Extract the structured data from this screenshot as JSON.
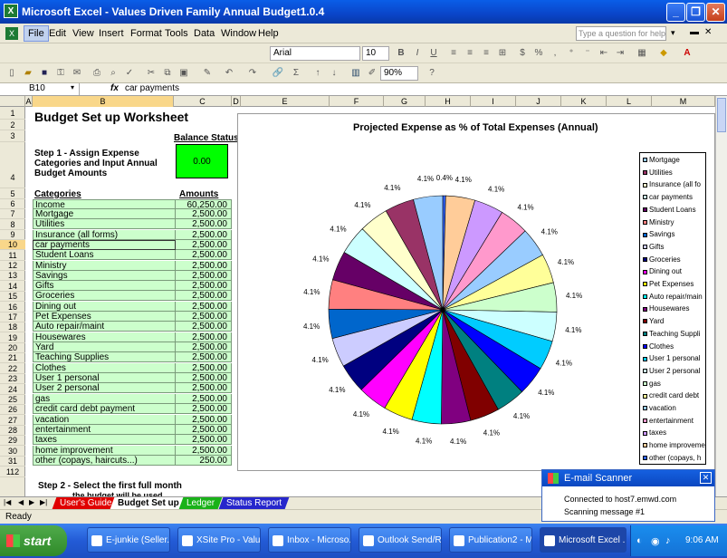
{
  "window": {
    "title": "Microsoft Excel - Values Driven Family Annual Budget1.0.4"
  },
  "menu": [
    "File",
    "Edit",
    "View",
    "Insert",
    "Format",
    "Tools",
    "Data",
    "Window",
    "Help"
  ],
  "help_placeholder": "Type a question for help",
  "format_bar": {
    "font": "Arial",
    "size": "10"
  },
  "std_bar": {
    "zoom": "90%"
  },
  "formula_bar": {
    "cell_ref": "B10",
    "fx": "fx",
    "content": "car payments"
  },
  "columns": [
    "A",
    "B",
    "C",
    "D",
    "E",
    "F",
    "G",
    "H",
    "I",
    "J",
    "K",
    "L",
    "M"
  ],
  "rows": [
    "1",
    "2",
    "3",
    "4",
    "5",
    "6",
    "7",
    "8",
    "9",
    "10",
    "11",
    "12",
    "13",
    "14",
    "15",
    "16",
    "17",
    "18",
    "19",
    "20",
    "21",
    "22",
    "23",
    "24",
    "25",
    "26",
    "27",
    "28",
    "29",
    "30",
    "31",
    "112"
  ],
  "sheet": {
    "title": "Budget Set up Worksheet",
    "balance_label": "Balance Status",
    "balance_value": "0.00",
    "step1_line1": "Step 1 -  Assign Expense",
    "step1_line2": "Categories and Input Annual",
    "step1_line3": "Budget Amounts",
    "categories_header": "Categories",
    "amounts_header": "Amounts",
    "items": [
      {
        "cat": "Income",
        "amt": "60,250.00"
      },
      {
        "cat": "Mortgage",
        "amt": "2,500.00"
      },
      {
        "cat": "Utilities",
        "amt": "2,500.00"
      },
      {
        "cat": "Insurance (all forms)",
        "amt": "2,500.00"
      },
      {
        "cat": "car payments",
        "amt": "2,500.00"
      },
      {
        "cat": "Student Loans",
        "amt": "2,500.00"
      },
      {
        "cat": "Ministry",
        "amt": "2,500.00"
      },
      {
        "cat": "Savings",
        "amt": "2,500.00"
      },
      {
        "cat": "Gifts",
        "amt": "2,500.00"
      },
      {
        "cat": "Groceries",
        "amt": "2,500.00"
      },
      {
        "cat": "Dining out",
        "amt": "2,500.00"
      },
      {
        "cat": "Pet Expenses",
        "amt": "2,500.00"
      },
      {
        "cat": "Auto repair/maint",
        "amt": "2,500.00"
      },
      {
        "cat": "Housewares",
        "amt": "2,500.00"
      },
      {
        "cat": "Yard",
        "amt": "2,500.00"
      },
      {
        "cat": "Teaching Supplies",
        "amt": "2,500.00"
      },
      {
        "cat": "Clothes",
        "amt": "2,500.00"
      },
      {
        "cat": "User 1 personal",
        "amt": "2,500.00"
      },
      {
        "cat": "User 2 personal",
        "amt": "2,500.00"
      },
      {
        "cat": "gas",
        "amt": "2,500.00"
      },
      {
        "cat": "credit card debt payment",
        "amt": "2,500.00"
      },
      {
        "cat": "vacation",
        "amt": "2,500.00"
      },
      {
        "cat": "entertainment",
        "amt": "2,500.00"
      },
      {
        "cat": "taxes",
        "amt": "2,500.00"
      },
      {
        "cat": "home improvement",
        "amt": "2,500.00"
      },
      {
        "cat": "other (copays, haircuts...)",
        "amt": "250.00"
      }
    ],
    "step2_line1": "Step 2 - Select the first full month",
    "step2_line2": "the budget will be used"
  },
  "chart_data": {
    "type": "pie",
    "title": "Projected Expense as % of Total Expenses (Annual)",
    "categories": [
      "Mortgage",
      "Utilities",
      "Insurance (all fo",
      "car payments",
      "Student Loans",
      "Ministry",
      "Savings",
      "Gifts",
      "Groceries",
      "Dining out",
      "Pet Expenses",
      "Auto repair/main",
      "Housewares",
      "Yard",
      "Teaching Suppli",
      "Clothes",
      "User 1 personal",
      "User 2 personal",
      "gas",
      "credit card debt",
      "vacation",
      "entertainment",
      "taxes",
      "home improveme",
      "other (copays, h"
    ],
    "values": [
      2500,
      2500,
      2500,
      2500,
      2500,
      2500,
      2500,
      2500,
      2500,
      2500,
      2500,
      2500,
      2500,
      2500,
      2500,
      2500,
      2500,
      2500,
      2500,
      2500,
      2500,
      2500,
      2500,
      2500,
      250
    ],
    "data_labels": [
      "4.1%",
      "4.1%",
      "4.1%",
      "4.1%",
      "4.1%",
      "4.1%",
      "4.1%",
      "4.1%",
      "4.1%",
      "4.1%",
      "4.1%",
      "4.1%",
      "4.1%",
      "4.1%",
      "4.1%",
      "4.1%",
      "4.1%",
      "4.1%",
      "4.1%",
      "4.1%",
      "4.1%",
      "4.1%",
      "4.1%",
      "4.1%",
      "0.4%"
    ],
    "colors": [
      "#99ccff",
      "#993366",
      "#ffffcc",
      "#ccffff",
      "#660066",
      "#ff8080",
      "#0066cc",
      "#ccccff",
      "#000080",
      "#ff00ff",
      "#ffff00",
      "#00ffff",
      "#800080",
      "#800000",
      "#008080",
      "#0000ff",
      "#00ccff",
      "#ccffff",
      "#ccffcc",
      "#ffff99",
      "#99ccff",
      "#ff99cc",
      "#cc99ff",
      "#ffcc99",
      "#3366ff"
    ],
    "legend": "right"
  },
  "sheet_tabs": [
    "User's Guide",
    "Budget Set up",
    "Ledger",
    "Status Report"
  ],
  "status": "Ready",
  "taskbar": {
    "start": "start",
    "buttons": [
      "E-junkie (Seller...",
      "XSite Pro - Valu...",
      "Inbox - Microso...",
      "Outlook Send/R...",
      "Publication2 - M...",
      "Microsoft Excel ..."
    ],
    "time": "9:06 AM"
  },
  "popup": {
    "title": "E-mail Scanner",
    "line1": "Connected to host7.emwd.com",
    "line2": "Scanning message #1"
  }
}
